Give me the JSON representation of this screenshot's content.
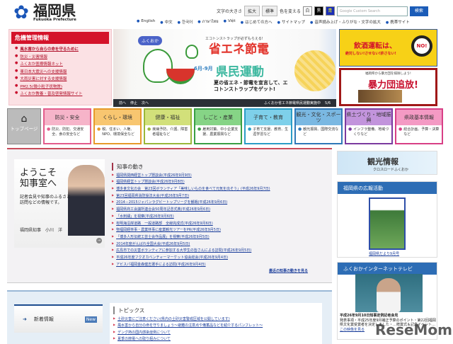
{
  "header": {
    "logo_title": "福岡県",
    "logo_subtitle": "Fukuoka Prefecture",
    "font_size_label": "文字の大きさ",
    "font_large": "拡大",
    "font_normal": "標準",
    "color_label": "色を変える",
    "color_white": "白",
    "color_black": "黒",
    "color_blue": "青",
    "search_placeholder": "Google Custom Search",
    "search_button": "検索",
    "links": [
      "English",
      "中文",
      "한국어",
      "ภาษาไทย",
      "Việt",
      "はじめての方へ",
      "サイトマップ",
      "音声読み上げ・ふりがな・文字の拡大",
      "携帯サイト"
    ]
  },
  "crisis": {
    "title": "危機管理情報",
    "items": [
      "風水害から自らの命を守るために",
      "防災・災害情報",
      "ふくおか医療情報ネット",
      "東日本大震災への支援情報",
      "大雨災害に対する支援情報",
      "PM2.5(微小粒子状物質)",
      "ふくおか教養・普及啓発情報サイト"
    ]
  },
  "banner": {
    "brand": "ふくおか",
    "sub": "エコトンストラップが必ずもらえる!",
    "title1": "省エネ節電",
    "months": "6月-9月",
    "title2": "県民運動",
    "copy": "夏の省エネ・節電を宣言して、エコトンストラップをゲット!",
    "prev": "前へ",
    "stop": "停止",
    "next": "次へ",
    "caption": "ふくおか省エネ節電県民運動実施中",
    "counter": "5/6"
  },
  "ads": {
    "drink_title": "飲酒運転は、",
    "drink_sub": "絶対しない!させない!許さない!",
    "drink_no": "NO!",
    "gang_sub": "福岡県から暴力団を排除しよう!",
    "gang_title": "暴力団追放!"
  },
  "nav": {
    "home": "トップページ",
    "tabs": [
      {
        "title": "防災・安全",
        "desc": "防災、防犯、交通安全、食の安全など",
        "color": "#e35d8c",
        "bg": "#f6b4c9"
      },
      {
        "title": "くらし・環境",
        "desc": "税、住まい、人権、NPO、環境保全など",
        "color": "#e79a2a",
        "bg": "#f8c670"
      },
      {
        "title": "健康・福祉",
        "desc": "疾病予防、介護、障害者福祉など",
        "color": "#9ab83a",
        "bg": "#d2e07a"
      },
      {
        "title": "しごと・産業",
        "desc": "雇用対策、中小企業支援、農業振興など",
        "color": "#3a9f45",
        "bg": "#86d486"
      },
      {
        "title": "子育て・教育",
        "desc": "子育て支援、教育、生涯学習など",
        "color": "#2b9dc6",
        "bg": "#7ed0ea"
      },
      {
        "title": "観光・文化・スポーツ",
        "desc": "観光振興、国際交流など",
        "color": "#2f78b8",
        "bg": "#7ab8e2"
      },
      {
        "title": "県土づくり・地域振興",
        "desc": "インフラ整備、地域づくりなど",
        "color": "#7b3a9f",
        "bg": "#c294dc"
      },
      {
        "title": "県政基本情報",
        "desc": "総合計画、予算・決算など",
        "color": "#d83f86",
        "bg": "#f49ac4"
      }
    ]
  },
  "governor": {
    "welcome": "ようこそ知事室へ",
    "message": "記者会見や知事のふるさと訪問などの情報です。",
    "name": "福岡県知事　小川　洋"
  },
  "news": {
    "title": "知事の動き",
    "items": [
      "福岡県関西経営トップ懇談会(平成26年9月9日)",
      "福岡県経営トップ懇談会(平成26年9月8日)",
      "博多食文化の会　第23回ボランティア「美味しいものを食べて元気を出そう」(平成26年9月7日)",
      "第23回福岡県消防操法大会(平成26年9月7日)",
      "2014－2015ジャパンラグビートップリーグを観戦(平成26年9月6日)",
      "福岡県商工会議所連合会50周年記念式典(平成26年9月6日)",
      "「水刺繍」を視察(平成26年9月6日)",
      "有明海沿岸道路　一般道路部　全線完成式(平成26年9月6日)",
      "物福岡経林事・農業林事に産業観光ツアーをPR(平成26年9月5日)",
      "「博多人形伝統工芸士会作品展」を視察(平成26年9月5日)",
      "2014年度がんばれ全国大会(平成26年9月5日)",
      "広島市での災害ボランティアに参加する大学生の皆さんによる訪問(平成26年9月5日)",
      "平成26年度フクオカベンチャーマーケット協会総会(平成26年9月4日)",
      "アビスパ福岡金森健志選手による訪問(平成26年9月4日)"
    ],
    "more": "最近の知事の動きを見る"
  },
  "right": {
    "kanko_title": "観光情報",
    "kanko_sub": "クロスロードふくおか",
    "koho_title": "福岡県の広報活動",
    "koho_link": "福岡県だより9月号",
    "tv_title": "ふくおかインターネットテレビ",
    "tv_headline": "平成26年9月10日知事定例記者会見",
    "tv_desc": "発表事項・平成25年度9月補正予算のポイント・第22回福岡県文化賞受賞者を決定しました・…贈賞式＆記念イベント…",
    "tv_link": "この映像を見る"
  },
  "bottom": {
    "new_label": "新着情報",
    "new_badge": "New",
    "topics_title": "トピックス",
    "topics": [
      "土砂災害にご注意ください(県内の土砂災害警戒区域を公開しています)",
      "風水害から自分の命を守りましょう～避難の注意点や備蓄品などを紹介するパンフレット～",
      "デング熱の国内感染症例について",
      "夏季の節電への取り組みについて"
    ]
  },
  "watermark": "ReseMom"
}
